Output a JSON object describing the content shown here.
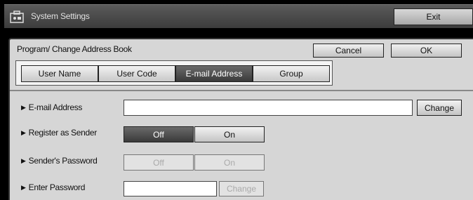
{
  "window": {
    "title": "System Settings",
    "exit_label": "Exit",
    "icon": "system-settings-icon"
  },
  "panel": {
    "title": "Program/ Change Address Book",
    "cancel_label": "Cancel",
    "ok_label": "OK"
  },
  "tabs": [
    {
      "label": "User Name",
      "active": false
    },
    {
      "label": "User Code",
      "active": false
    },
    {
      "label": "E-mail Address",
      "active": true
    },
    {
      "label": "Group",
      "active": false
    }
  ],
  "fields": {
    "email": {
      "label": "E-mail Address",
      "value": "",
      "change_label": "Change"
    },
    "register_sender": {
      "label": "Register as Sender",
      "off_label": "Off",
      "on_label": "On",
      "selected": "Off"
    },
    "sender_password": {
      "label": "Sender's Password",
      "off_label": "Off",
      "on_label": "On",
      "enabled": false
    },
    "enter_password": {
      "label": "Enter Password",
      "value": "",
      "change_label": "Change",
      "change_enabled": false
    }
  },
  "colors": {
    "active_button": "#4a4a4a",
    "panel_bg": "#d6d6d6"
  }
}
